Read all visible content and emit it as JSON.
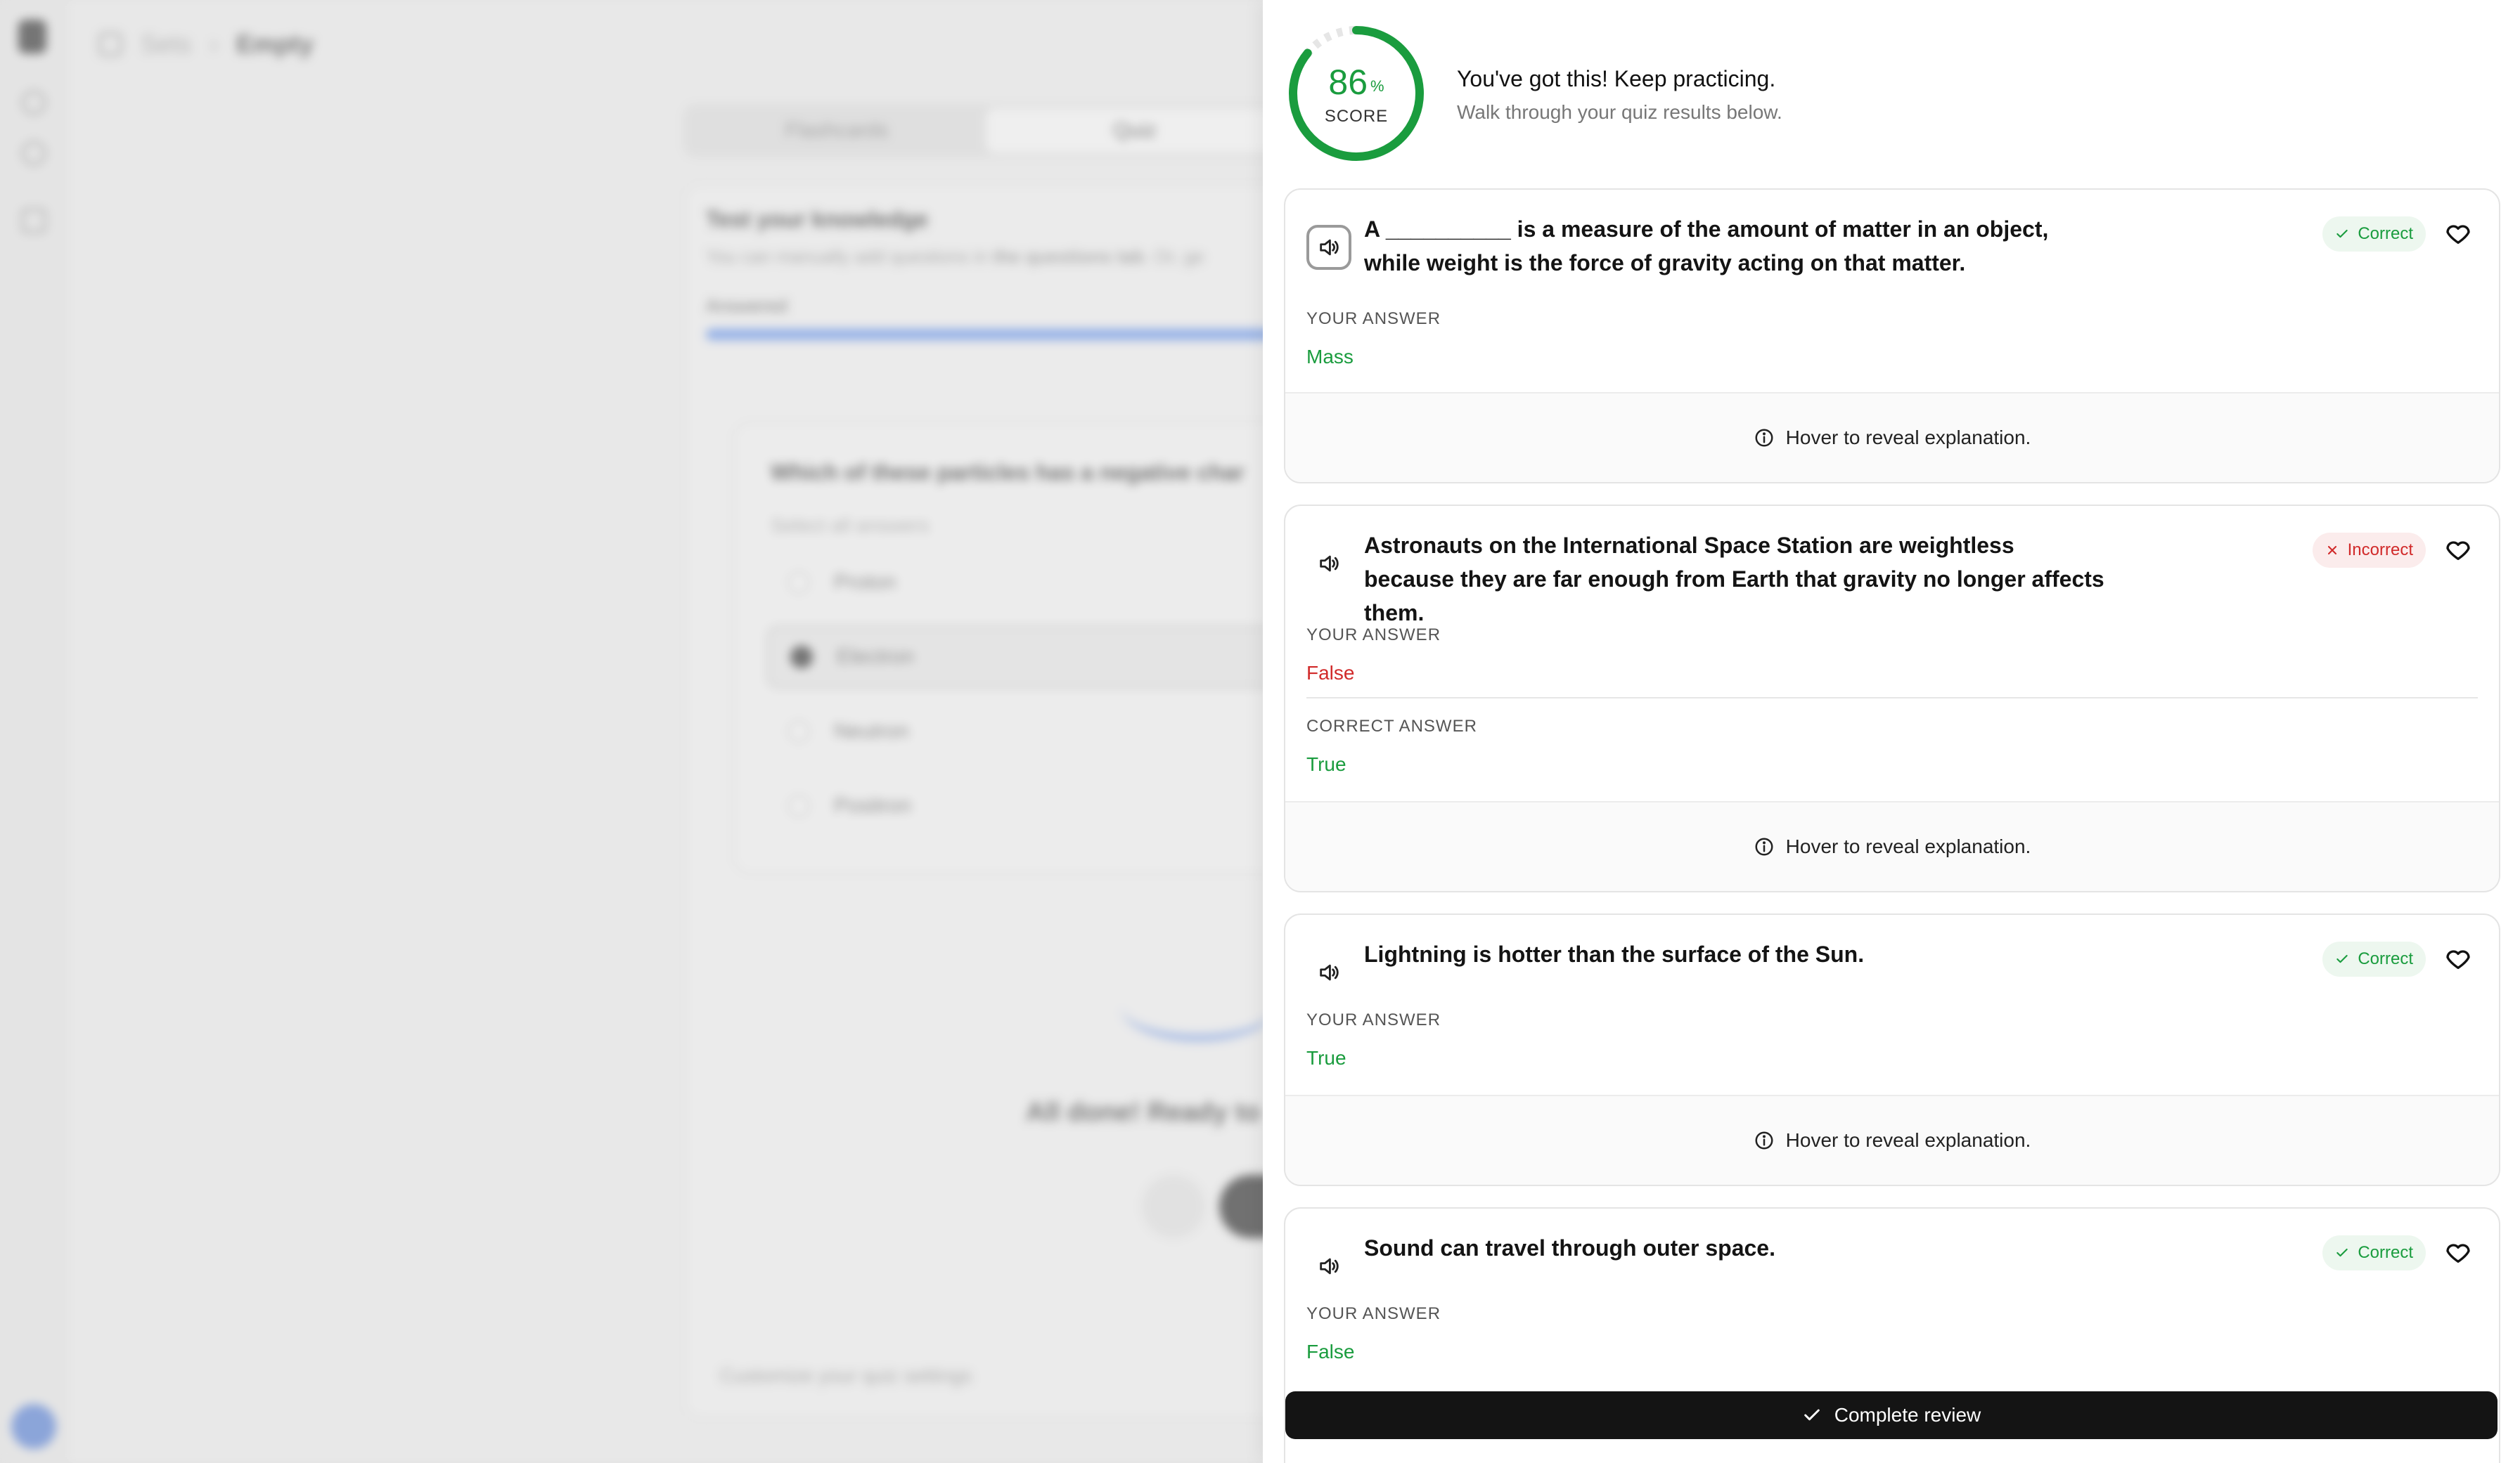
{
  "background": {
    "breadcrumb": {
      "parent": "Sets",
      "current": "Empty"
    },
    "tabs": [
      "Flashcards",
      "Quiz"
    ],
    "card": {
      "heading": "Test your knowledge",
      "subtitle_start": "You can manually add questions in ",
      "subtitle_bold": "the questions tab",
      "subtitle_end": ". Or, ge",
      "answered_label": "Answered"
    },
    "question": {
      "text": "Which of these particles has a negative char",
      "hint": "Select all answers",
      "options": [
        "Proton",
        "Electron",
        "Neutron",
        "Positron"
      ]
    },
    "done_text": "All done! Ready to",
    "customize_text": "Customize your quiz settings"
  },
  "review": {
    "score": {
      "value": "86",
      "unit": "%",
      "label": "SCORE",
      "fraction": 0.86
    },
    "title": "You've got this! Keep practicing.",
    "subtitle": "Walk through your quiz results below.",
    "labels": {
      "your_answer": "YOUR ANSWER",
      "correct_answer": "CORRECT ANSWER",
      "explanation": "Hover to reveal explanation."
    },
    "questions": [
      {
        "text": "A __________ is a measure of the amount of matter in an object, while weight is the force of gravity acting on that matter.",
        "status": "Correct",
        "your_answer": "Mass"
      },
      {
        "text": "Astronauts on the International Space Station are weightless because they are far enough from Earth that gravity no longer affects them.",
        "status": "Incorrect",
        "your_answer": "False",
        "correct_answer": "True"
      },
      {
        "text": "Lightning is hotter than the surface of the Sun.",
        "status": "Correct",
        "your_answer": "True"
      },
      {
        "text": "Sound can travel through outer space.",
        "status": "Correct",
        "your_answer": "False"
      }
    ],
    "complete_button": "Complete review"
  },
  "colors": {
    "correct": "#1a9c3e",
    "incorrect": "#d12a2a",
    "button": "#141414"
  },
  "icons": [
    "speaker-icon",
    "check-icon",
    "x-icon",
    "heart-icon",
    "info-icon"
  ]
}
